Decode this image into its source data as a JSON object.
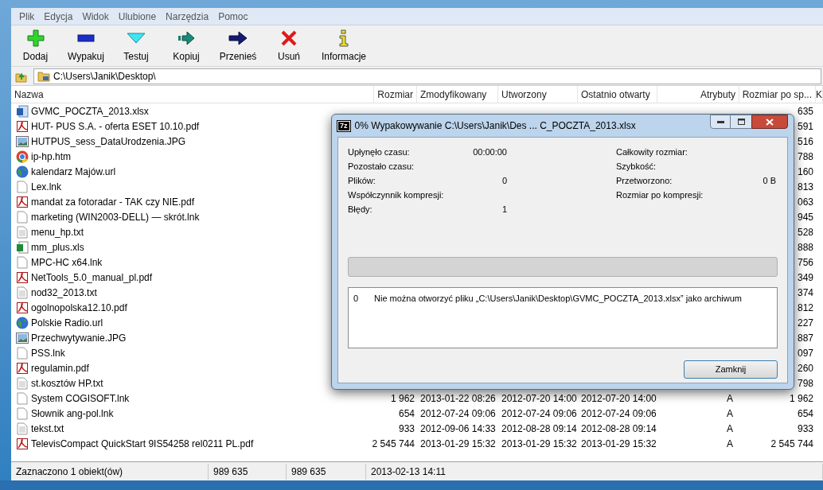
{
  "menu": [
    "Plik",
    "Edycja",
    "Widok",
    "Ulubione",
    "Narzędzia",
    "Pomoc"
  ],
  "toolbar": [
    {
      "label": "Dodaj",
      "kind": "add"
    },
    {
      "label": "Wypakuj",
      "kind": "extract"
    },
    {
      "label": "Testuj",
      "kind": "test"
    },
    {
      "label": "Kopiuj",
      "kind": "copy"
    },
    {
      "label": "Przenieś",
      "kind": "move"
    },
    {
      "label": "Usuń",
      "kind": "delete"
    },
    {
      "label": "Informacje",
      "kind": "info"
    }
  ],
  "address": {
    "path": "C:\\Users\\Janik\\Desktop\\"
  },
  "columns": [
    "Nazwa",
    "Rozmiar",
    "Zmodyfikowany",
    "Utworzony",
    "Ostatnio otwarty",
    "Atrybuty",
    "Rozmiar po sp...",
    "K"
  ],
  "rows": [
    {
      "name": "GVMC_POCZTA_2013.xlsx",
      "kind": "xlsx",
      "cells": [
        "635"
      ]
    },
    {
      "name": "HUT- PUS  S.A. - oferta ESET 10.10.pdf",
      "kind": "pdf",
      "cells": [
        "591"
      ]
    },
    {
      "name": "HUTPUS_sess_DataUrodzenia.JPG",
      "kind": "image",
      "cells": [
        "516"
      ]
    },
    {
      "name": "ip-hp.htm",
      "kind": "chrome",
      "cells": [
        "788"
      ]
    },
    {
      "name": "kalendarz Majów.url",
      "kind": "globe",
      "cells": [
        "160"
      ]
    },
    {
      "name": "Lex.lnk",
      "kind": "file",
      "cells": [
        "813"
      ]
    },
    {
      "name": "mandat za fotoradar - TAK czy NIE.pdf",
      "kind": "pdf",
      "cells": [
        "063"
      ]
    },
    {
      "name": "marketing (WIN2003-DELL) — skrót.lnk",
      "kind": "file",
      "cells": [
        "945"
      ]
    },
    {
      "name": "menu_hp.txt",
      "kind": "text",
      "cells": [
        "528"
      ]
    },
    {
      "name": "mm_plus.xls",
      "kind": "xls",
      "cells": [
        "888"
      ]
    },
    {
      "name": "MPC-HC x64.lnk",
      "kind": "file",
      "cells": [
        "756"
      ]
    },
    {
      "name": "NetTools_5.0_manual_pl.pdf",
      "kind": "pdf",
      "cells": [
        "349"
      ]
    },
    {
      "name": "nod32_2013.txt",
      "kind": "text",
      "cells": [
        "374"
      ]
    },
    {
      "name": "ogolnopolska12.10.pdf",
      "kind": "pdf",
      "cells": [
        "812"
      ]
    },
    {
      "name": "Polskie Radio.url",
      "kind": "globe",
      "cells": [
        "227"
      ]
    },
    {
      "name": "Przechwytywanie.JPG",
      "kind": "image",
      "cells": [
        "887"
      ]
    },
    {
      "name": "PSS.lnk",
      "kind": "file",
      "cells": [
        "097"
      ]
    },
    {
      "name": "regulamin.pdf",
      "kind": "pdf",
      "cells": [
        "260"
      ]
    },
    {
      "name": "st.kosztów HP.txt",
      "kind": "text",
      "cells": [
        "798"
      ]
    },
    {
      "name": "System COGISOFT.lnk",
      "kind": "file",
      "cells": [
        "1 962",
        "2013-01-22 08:26",
        "2012-07-20 14:00",
        "2012-07-20 14:00",
        "A",
        "1 962"
      ]
    },
    {
      "name": "Słownik ang-pol.lnk",
      "kind": "file",
      "cells": [
        "654",
        "2012-07-24 09:06",
        "2012-07-24 09:06",
        "2012-07-24 09:06",
        "A",
        "654"
      ]
    },
    {
      "name": "tekst.txt",
      "kind": "text",
      "cells": [
        "933",
        "2012-09-06 14:33",
        "2012-08-28 09:14",
        "2012-08-28 09:14",
        "A",
        "933"
      ]
    },
    {
      "name": "TelevisCompact QuickStart 9IS54258 rel0211 PL.pdf",
      "kind": "pdf",
      "cells": [
        "2 545 744",
        "2013-01-29 15:32",
        "2013-01-29 15:32",
        "2013-01-29 15:32",
        "A",
        "2 545 744"
      ]
    }
  ],
  "status_bar": [
    "Zaznaczono 1 obiekt(ów)",
    "989 635",
    "989 635",
    "2013-02-13 14:11"
  ],
  "dialog": {
    "title": "0% Wypakowywanie C:\\Users\\Janik\\Des ... C_POCZTA_2013.xlsx",
    "icon_text": "7z",
    "stats_left": [
      {
        "label": "Upłynęło czasu:",
        "value": "00:00:00"
      },
      {
        "label": "Pozostało czasu:"
      },
      {
        "label": "Plików:",
        "value": "0"
      },
      {
        "label": "Współczynnik kompresji:"
      },
      {
        "label": "Błędy:",
        "value": "1"
      }
    ],
    "stats_right": [
      {
        "label": "Całkowity rozmiar:"
      },
      {
        "label": "Szybkość:"
      },
      {
        "label": "Przetworzono:",
        "value": "0 B"
      },
      {
        "label": "Rozmiar po kompresji:"
      }
    ],
    "progress": {
      "level": 0
    },
    "log": [
      {
        "index": "0",
        "message": "Nie można otworzyć pliku „C:\\Users\\Janik\\Desktop\\GVMC_POCZTA_2013.xlsx” jako archiwum"
      }
    ],
    "button": "Zamknij"
  }
}
